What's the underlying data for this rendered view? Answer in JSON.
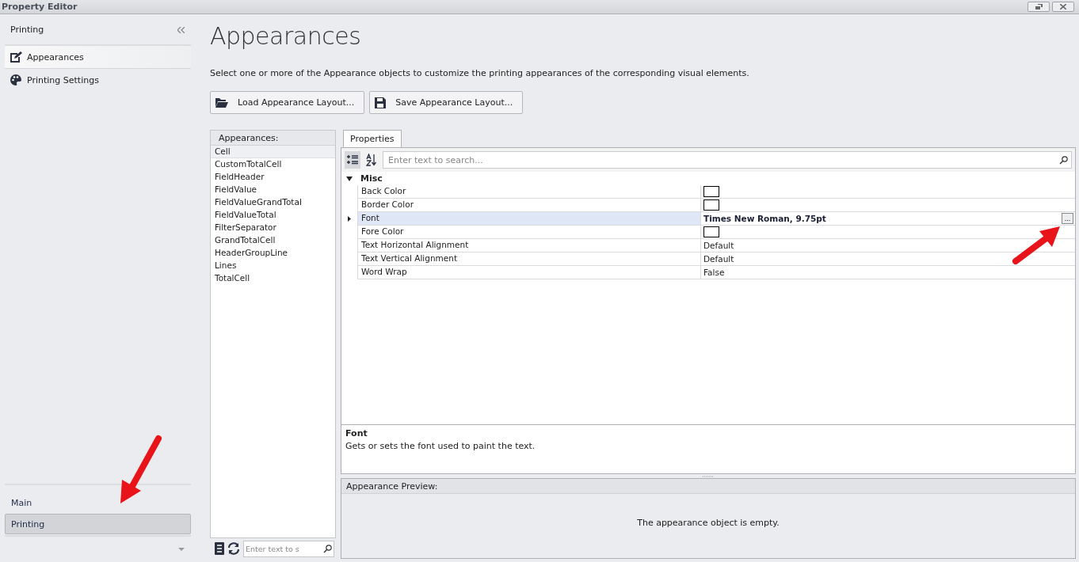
{
  "window": {
    "title": "Property Editor"
  },
  "sidebar": {
    "title": "Printing",
    "items": [
      {
        "label": "Appearances",
        "kind": "edit",
        "selected": true
      },
      {
        "label": "Printing Settings",
        "kind": "palette",
        "selected": false
      }
    ],
    "groups": [
      {
        "label": "Main",
        "selected": false
      },
      {
        "label": "Printing",
        "selected": true
      }
    ]
  },
  "page": {
    "title": "Appearances",
    "description": "Select one or more of the Appearance objects to customize the printing appearances of the corresponding visual elements.",
    "buttons": [
      {
        "label": "Load Appearance Layout...",
        "kind": "folder"
      },
      {
        "label": "Save Appearance Layout...",
        "kind": "save"
      }
    ]
  },
  "appearances": {
    "header": "Appearances:",
    "items": [
      {
        "label": "Cell",
        "selected": true
      },
      {
        "label": "CustomTotalCell",
        "selected": false
      },
      {
        "label": "FieldHeader",
        "selected": false
      },
      {
        "label": "FieldValue",
        "selected": false
      },
      {
        "label": "FieldValueGrandTotal",
        "selected": false
      },
      {
        "label": "FieldValueTotal",
        "selected": false
      },
      {
        "label": "FilterSeparator",
        "selected": false
      },
      {
        "label": "GrandTotalCell",
        "selected": false
      },
      {
        "label": "HeaderGroupLine",
        "selected": false
      },
      {
        "label": "Lines",
        "selected": false
      },
      {
        "label": "TotalCell",
        "selected": false
      }
    ],
    "search": {
      "placeholder": "Enter text to s"
    }
  },
  "properties": {
    "tabs": [
      {
        "label": "Properties",
        "selected": true
      }
    ],
    "search": {
      "placeholder": "Enter text to search..."
    },
    "category": {
      "label": "Misc",
      "expanded": true
    },
    "rows": [
      {
        "name": "Back Color",
        "kind": "color",
        "expandable": false,
        "selected": false
      },
      {
        "name": "Border Color",
        "kind": "color",
        "expandable": false,
        "selected": false
      },
      {
        "name": "Font",
        "kind": "text",
        "value": "Times New Roman, 9.75pt",
        "modified": true,
        "expandable": true,
        "selected": true
      },
      {
        "name": "Fore Color",
        "kind": "color",
        "expandable": false,
        "selected": false
      },
      {
        "name": "Text Horizontal Alignment",
        "kind": "text",
        "value": "Default",
        "modified": false,
        "expandable": false,
        "selected": false
      },
      {
        "name": "Text Vertical Alignment",
        "kind": "text",
        "value": "Default",
        "modified": false,
        "expandable": false,
        "selected": false
      },
      {
        "name": "Word Wrap",
        "kind": "text",
        "value": "False",
        "modified": false,
        "expandable": false,
        "selected": false
      }
    ],
    "ellipsis": "...",
    "help": {
      "title": "Font",
      "text": "Gets or sets the font used to paint the text."
    }
  },
  "preview": {
    "header": "Appearance Preview:",
    "message": "The appearance object is empty."
  }
}
